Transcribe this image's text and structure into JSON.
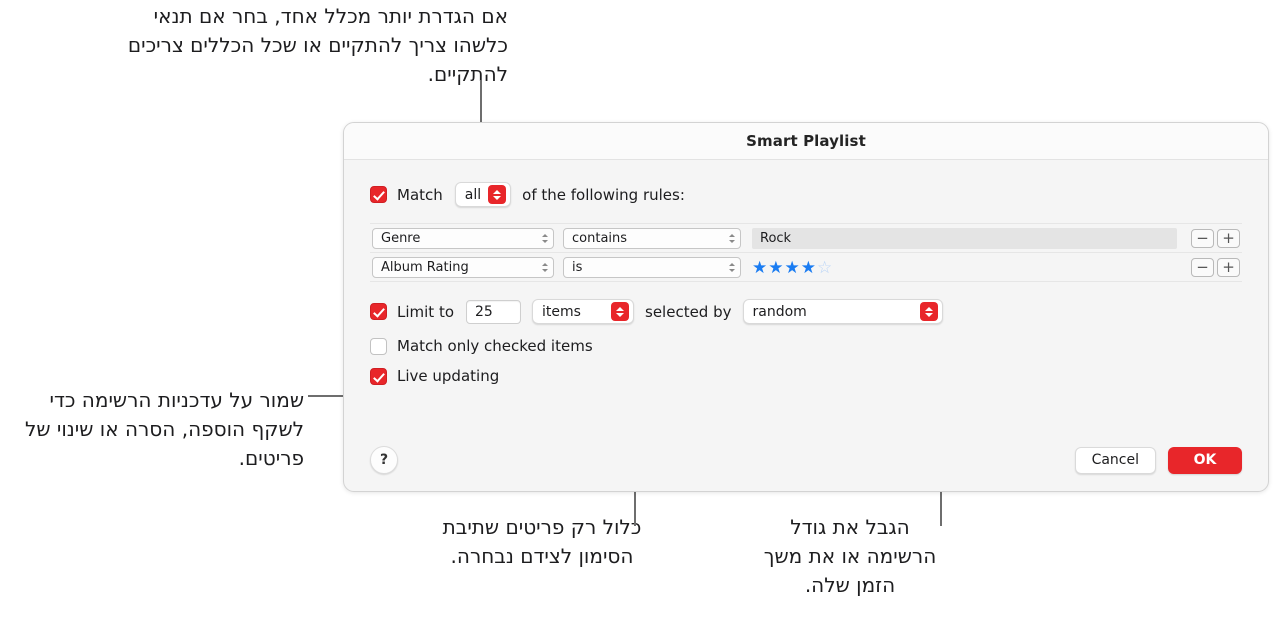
{
  "dialog": {
    "title": "Smart Playlist",
    "match": {
      "checked": true,
      "label": "Match",
      "operator_value": "all",
      "suffix_label": "of the following rules:"
    },
    "rules": [
      {
        "field": "Genre",
        "operator": "contains",
        "value_type": "text",
        "value": "Rock",
        "remove_label": "−",
        "add_label": "+"
      },
      {
        "field": "Album Rating",
        "operator": "is",
        "value_type": "stars",
        "stars_filled": 4,
        "stars_total": 5,
        "remove_label": "−",
        "add_label": "+"
      }
    ],
    "limit": {
      "checked": true,
      "label": "Limit to",
      "amount": "25",
      "unit": "items",
      "selected_by_label": "selected by",
      "selected_by_value": "random"
    },
    "match_only_checked": {
      "checked": false,
      "label": "Match only checked items"
    },
    "live_updating": {
      "checked": true,
      "label": "Live updating"
    },
    "help_label": "?",
    "cancel_label": "Cancel",
    "ok_label": "OK"
  },
  "callouts": {
    "match_rules": "אם הגדרת יותר מכלל אחד, בחר אם תנאי כלשהו צריך להתקיים או שכל הכללים צריכים להתקיים.",
    "live_updating": "שמור על עדכניות הרשימה כדי לשקף הוספה, הסרה או שינוי של פריטים.",
    "match_only_checked": "כלול רק פריטים שתיבת הסימון לצידם נבחרה.",
    "limit": "הגבל את גודל הרשימה או את משך הזמן שלה."
  },
  "colors": {
    "accent_red": "#e8262a",
    "star_blue": "#1a7cf2",
    "leader_gray": "#6e6e6e"
  }
}
